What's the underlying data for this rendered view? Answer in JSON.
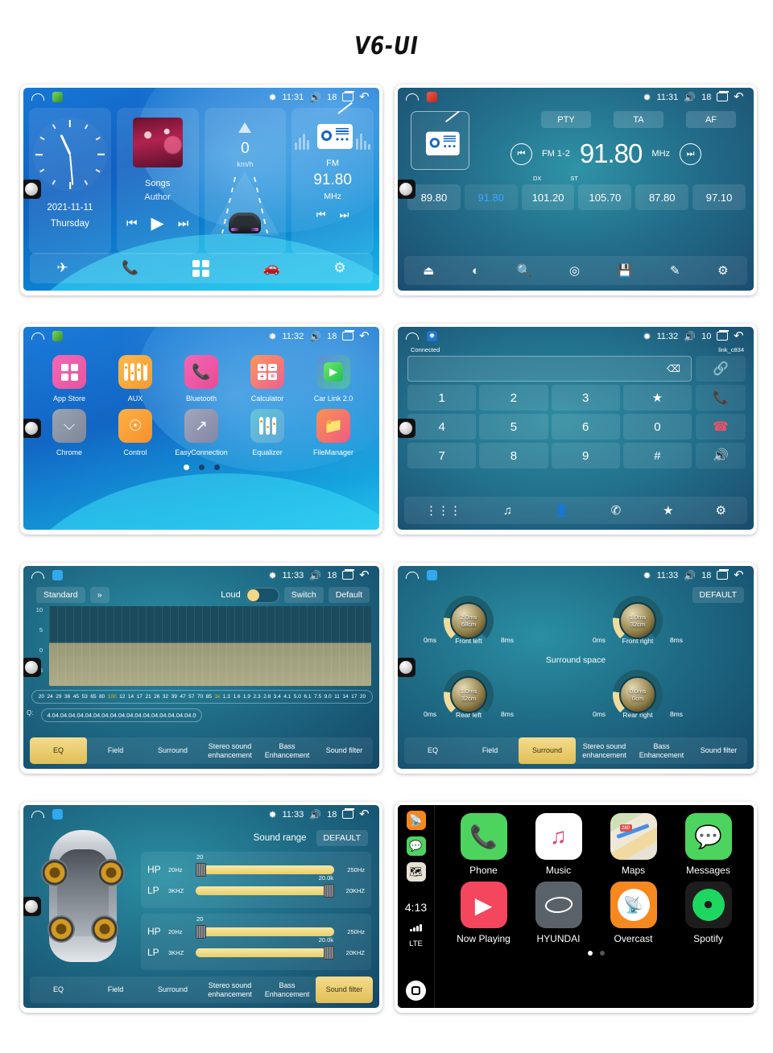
{
  "title": "V6-UI",
  "statusbar": {
    "home_icon": "home-icon",
    "time_1131": "11:31",
    "time_1132": "11:32",
    "time_1133": "11:33",
    "volume_18": "18",
    "volume_10": "10",
    "bt_icon": "bluetooth-icon",
    "vol_icon": "volume-icon",
    "recents_icon": "recents-icon",
    "back_icon": "back-icon"
  },
  "home": {
    "clock": {
      "date": "2021-11-11",
      "day": "Thursday"
    },
    "music": {
      "song": "Songs",
      "artist": "Author",
      "prev": "⏮",
      "play": "▶",
      "next": "⏭"
    },
    "speed": {
      "value": "0",
      "unit": "km/h"
    },
    "radio": {
      "band": "FM",
      "freq": "91.80",
      "unit": "MHz",
      "prev": "⏮",
      "next": "⏭"
    },
    "dock": [
      "navigation-icon",
      "phone-icon",
      "apps-icon",
      "carlink-icon",
      "settings-icon"
    ]
  },
  "radio": {
    "rds": [
      "PTY",
      "TA",
      "AF"
    ],
    "band": "FM 1-2",
    "freq": "91.80",
    "unit": "MHz",
    "dx": "DX",
    "st": "ST",
    "presets": [
      "89.80",
      "91.80",
      "101.20",
      "105.70",
      "87.80",
      "97.10"
    ],
    "active_preset": 1,
    "dock": [
      "loop-icon",
      "band-icon",
      "search-icon",
      "scan-icon",
      "save-icon",
      "edit-icon",
      "settings-icon"
    ]
  },
  "apps": {
    "items": [
      {
        "label": "App Store",
        "icon": "appstore-icon",
        "color1": "#f268b6",
        "color2": "#e8539f"
      },
      {
        "label": "AUX",
        "icon": "aux-icon",
        "color1": "#fcb84b",
        "color2": "#f79a2e"
      },
      {
        "label": "Bluetooth",
        "icon": "phone-icon",
        "color1": "#f268b6",
        "color2": "#ea4a95"
      },
      {
        "label": "Calculator",
        "icon": "calculator-icon",
        "color1": "#f8985c",
        "color2": "#ef5f8e"
      },
      {
        "label": "Car Link 2.0",
        "icon": "carlink-icon",
        "color1": "#5b8fd6",
        "color2": "#4ec0a8"
      },
      {
        "label": "Chrome",
        "icon": "chrome-icon",
        "color1": "#9aa3b4",
        "color2": "#7d8798"
      },
      {
        "label": "Control",
        "icon": "steering-icon",
        "color1": "#fcb146",
        "color2": "#f7902c"
      },
      {
        "label": "EasyConnection",
        "icon": "share-icon",
        "color1": "#a3a6bd",
        "color2": "#8186a6"
      },
      {
        "label": "Equalizer",
        "icon": "equalizer-icon",
        "color1": "#64c4d8",
        "color2": "#5fa8da"
      },
      {
        "label": "FileManager",
        "icon": "folder-icon",
        "color1": "#f7934f",
        "color2": "#ef5a86"
      }
    ],
    "pages": 3,
    "active_page": 0
  },
  "dialer": {
    "status": "Connected",
    "device": "link_c834",
    "input_value": "",
    "backspace_icon": "backspace-icon",
    "keys": [
      "1",
      "2",
      "3",
      "★",
      "4",
      "5",
      "6",
      "0",
      "7",
      "8",
      "9",
      "#"
    ],
    "side_keys": [
      "link-icon",
      "call-icon",
      "hangup-icon",
      "speaker-icon"
    ],
    "dock": [
      "keypad-icon",
      "music-icon",
      "contacts-icon",
      "calllog-icon",
      "bluetooth-pair-icon",
      "settings-icon"
    ]
  },
  "eq": {
    "preset": "Standard",
    "chevron": "»",
    "loud_label": "Loud",
    "loud_on": true,
    "switch_label": "Switch",
    "default_label": "Default",
    "y_ticks": [
      "10",
      "5",
      "0",
      "-5"
    ],
    "frequencies": [
      "20",
      "24",
      "29",
      "36",
      "45",
      "53",
      "65",
      "80",
      "100",
      "12",
      "14",
      "17",
      "21",
      "26",
      "32",
      "39",
      "47",
      "57",
      "70",
      "85",
      "1k",
      "1.3",
      "1.6",
      "1.9",
      "2.3",
      "2.8",
      "3.4",
      "4.1",
      "5.0",
      "6.1",
      "7.5",
      "9.0",
      "11",
      "14",
      "17",
      "20"
    ],
    "highlight_freqs": [
      "100",
      "1k"
    ],
    "q_label": "Q:",
    "q_values": [
      "4.0",
      "4.0",
      "4.0",
      "4.0",
      "4.0",
      "4.0",
      "4.0",
      "4.0",
      "4.0",
      "4.0",
      "4.0",
      "4.0",
      "4.0",
      "4.0",
      "4.0",
      "4.0",
      "4.0",
      "4.0"
    ],
    "tabs": [
      "EQ",
      "Field",
      "Surround",
      "Stereo sound enhancement",
      "Bass Enhancement",
      "Sound filter"
    ],
    "active_tab": 0
  },
  "surround": {
    "title": "Surround space",
    "default_label": "DEFAULT",
    "knobs": [
      {
        "name": "Front left",
        "delay": "2.0ms",
        "distance": "68cm",
        "min": "0ms",
        "max": "8ms"
      },
      {
        "name": "Front right",
        "delay": "1.0ms",
        "distance": "32cm",
        "min": "0ms",
        "max": "8ms"
      },
      {
        "name": "Rear left",
        "delay": "1.0ms",
        "distance": "32cm",
        "min": "0ms",
        "max": "8ms"
      },
      {
        "name": "Rear right",
        "delay": "0.0ms",
        "distance": "0cm",
        "min": "0ms",
        "max": "8ms"
      }
    ],
    "active_tab": 2
  },
  "filter": {
    "title": "Sound range",
    "default_label": "DEFAULT",
    "groups": [
      {
        "hp": {
          "tag": "HP",
          "min": "20Hz",
          "max": "250Hz",
          "value": "20"
        },
        "lp": {
          "tag": "LP",
          "min": "3KHZ",
          "max": "20KHZ",
          "value": "20.0k"
        }
      },
      {
        "hp": {
          "tag": "HP",
          "min": "20Hz",
          "max": "250Hz",
          "value": "20"
        },
        "lp": {
          "tag": "LP",
          "min": "3KHZ",
          "max": "20KHZ",
          "value": "20.0k"
        }
      }
    ],
    "active_tab": 5
  },
  "carplay": {
    "time": "4:13",
    "network": "LTE",
    "sidebar_icons": [
      "overcast-icon",
      "messages-icon",
      "maps-icon"
    ],
    "home_icon": "home-button-icon",
    "apps": [
      {
        "label": "Phone",
        "icon": "phone-icon",
        "color": "#4cd45e"
      },
      {
        "label": "Music",
        "icon": "music-icon",
        "color": "#ffffff"
      },
      {
        "label": "Maps",
        "icon": "maps-icon",
        "color": "#e8e2d4"
      },
      {
        "label": "Messages",
        "icon": "messages-icon",
        "color": "#4cd45e"
      },
      {
        "label": "Now Playing",
        "icon": "play-icon",
        "color": "#f4465c"
      },
      {
        "label": "HYUNDAI",
        "icon": "hyundai-icon",
        "color": "#5a6269"
      },
      {
        "label": "Overcast",
        "icon": "overcast-icon",
        "color": "#f5881f"
      },
      {
        "label": "Spotify",
        "icon": "spotify-icon",
        "color": "#1d1d1d"
      }
    ],
    "pages": 2,
    "active_page": 0
  }
}
